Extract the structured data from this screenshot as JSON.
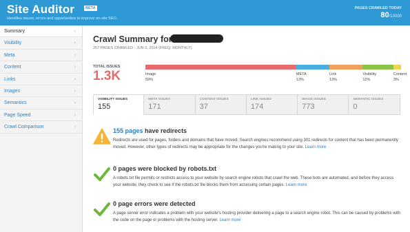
{
  "header": {
    "title": "Site Auditor",
    "beta": "BETA",
    "subtitle": "Identifies issues, errors and opportunities to improve on-site SEO.",
    "pages_crawled_label": "PAGES CRAWLED TODAY",
    "pages_crawled_value": "80",
    "pages_crawled_max": "/10000"
  },
  "sidebar": {
    "items": [
      {
        "label": "Summary"
      },
      {
        "label": "Visibility"
      },
      {
        "label": "Meta"
      },
      {
        "label": "Content"
      },
      {
        "label": "Links"
      },
      {
        "label": "Images"
      },
      {
        "label": "Semantics"
      },
      {
        "label": "Page Speed"
      },
      {
        "label": "Crawl Comparison"
      }
    ],
    "chevron": "›"
  },
  "summary": {
    "title": "Crawl Summary for",
    "meta": "257 PAGES CRAWLED - JUN 3, 2014 (FREQ: MONTHLY)",
    "total_label": "TOTAL ISSUES",
    "total_value": "1.3K",
    "segments": [
      {
        "name": "Image",
        "pct": "59%",
        "value": 59,
        "color": "#e86b6b"
      },
      {
        "name": "META",
        "pct": "13%",
        "value": 13,
        "color": "#4aaee3"
      },
      {
        "name": "Link",
        "pct": "13%",
        "value": 13,
        "color": "#f0a05a"
      },
      {
        "name": "Visibility",
        "pct": "12%",
        "value": 12,
        "color": "#8bc34a"
      },
      {
        "name": "Content",
        "pct": "3%",
        "value": 3,
        "color": "#f3d34a"
      }
    ]
  },
  "tabs": [
    {
      "label": "VISIBILITY ISSUES",
      "value": "155"
    },
    {
      "label": "META ISSUES",
      "value": "171"
    },
    {
      "label": "CONTENT ISSUES",
      "value": "37"
    },
    {
      "label": "LINK ISSUES",
      "value": "174"
    },
    {
      "label": "IMAGE ISSUES",
      "value": "773"
    },
    {
      "label": "SEMANTIC ISSUES",
      "value": "0"
    }
  ],
  "issues": {
    "redirects": {
      "count": "155 pages",
      "title_rest": " have redirects",
      "text": "Redirects are used for pages, folders and domains that have moved. Search engines recommend using 301 redirects for content that has been permanently moved. However, other types of redirects may be appropriate for the changes you're making to your site. ",
      "more": "Learn more"
    },
    "robots": {
      "title": "0 pages were blocked by robots.txt",
      "text": "A robots.txt file permits or restricts access to your website by search engine robots that crawl the web. These bots are automated, and before they access your website, they check to see if the robots.txt file blocks them from accessing certain pages. ",
      "more": "Learn more"
    },
    "errors": {
      "title": "0 page errors were detected",
      "text": "A page server error indicates a problem with your website's hosting provider delivering a page to a search engine robot. This can be caused by problems with the code on the page or problems with the hosting server. ",
      "more": "Learn more"
    }
  }
}
